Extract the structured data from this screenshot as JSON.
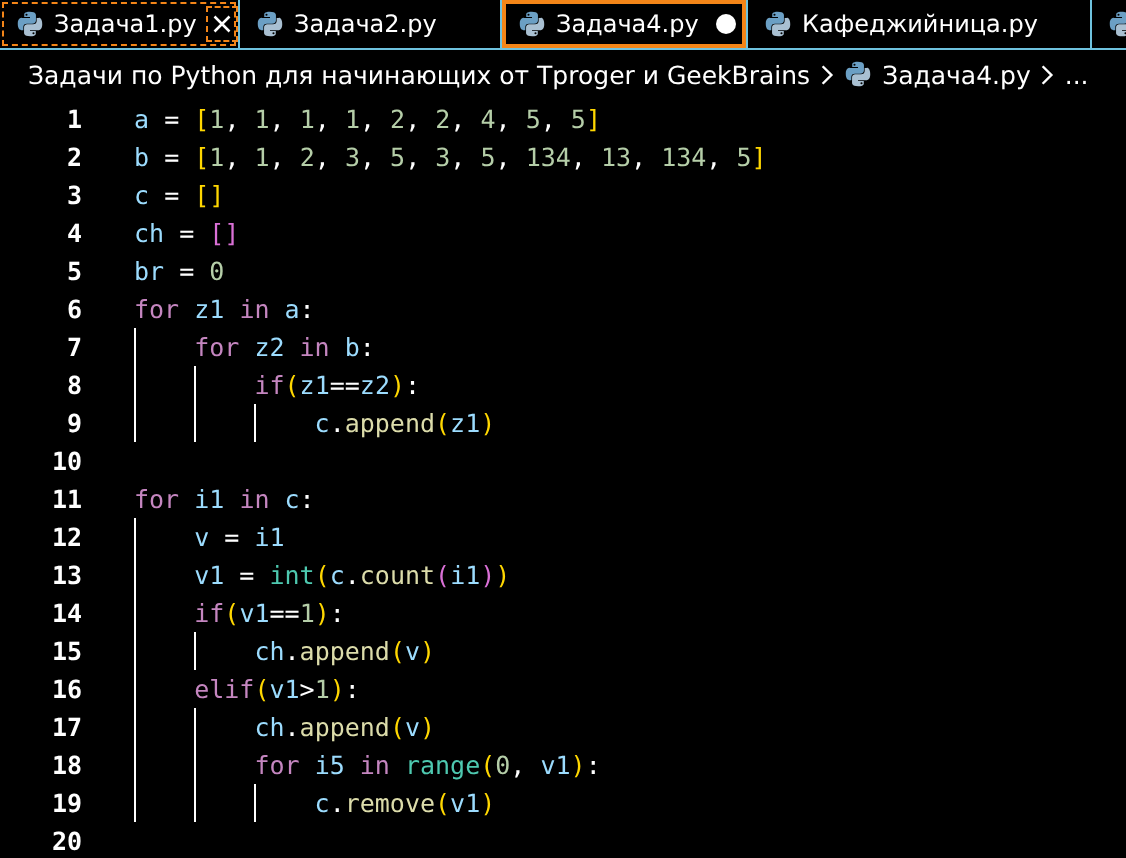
{
  "tabs": [
    {
      "label": "Задача1.py",
      "selected": false,
      "focused": true,
      "modified": false
    },
    {
      "label": "Задача2.py",
      "selected": false,
      "focused": false,
      "modified": false
    },
    {
      "label": "Задача4.py",
      "selected": true,
      "focused": false,
      "modified": true
    },
    {
      "label": "Кафеджийница.py",
      "selected": false,
      "focused": false,
      "modified": false
    }
  ],
  "partial_tab": true,
  "breadcrumb": {
    "folder": "Задачи по Python для начинающих от Tproger и GeekBrains",
    "file": "Задача4.py",
    "more": "..."
  },
  "editor": {
    "lines": [
      {
        "number": "1",
        "tokens": [
          {
            "kind": "var",
            "text": "a "
          },
          {
            "kind": "op",
            "text": "= "
          },
          {
            "kind": "bracket",
            "text": "["
          },
          {
            "kind": "num",
            "text": "1"
          },
          {
            "kind": "op",
            "text": ", "
          },
          {
            "kind": "num",
            "text": "1"
          },
          {
            "kind": "op",
            "text": ", "
          },
          {
            "kind": "num",
            "text": "1"
          },
          {
            "kind": "op",
            "text": ", "
          },
          {
            "kind": "num",
            "text": "1"
          },
          {
            "kind": "op",
            "text": ", "
          },
          {
            "kind": "num",
            "text": "2"
          },
          {
            "kind": "op",
            "text": ", "
          },
          {
            "kind": "num",
            "text": "2"
          },
          {
            "kind": "op",
            "text": ", "
          },
          {
            "kind": "num",
            "text": "4"
          },
          {
            "kind": "op",
            "text": ", "
          },
          {
            "kind": "num",
            "text": "5"
          },
          {
            "kind": "op",
            "text": ", "
          },
          {
            "kind": "num",
            "text": "5"
          },
          {
            "kind": "bracket",
            "text": "]"
          }
        ]
      },
      {
        "number": "2",
        "tokens": [
          {
            "kind": "var",
            "text": "b "
          },
          {
            "kind": "op",
            "text": "= "
          },
          {
            "kind": "bracket",
            "text": "["
          },
          {
            "kind": "num",
            "text": "1"
          },
          {
            "kind": "op",
            "text": ", "
          },
          {
            "kind": "num",
            "text": "1"
          },
          {
            "kind": "op",
            "text": ", "
          },
          {
            "kind": "num",
            "text": "2"
          },
          {
            "kind": "op",
            "text": ", "
          },
          {
            "kind": "num",
            "text": "3"
          },
          {
            "kind": "op",
            "text": ", "
          },
          {
            "kind": "num",
            "text": "5"
          },
          {
            "kind": "op",
            "text": ", "
          },
          {
            "kind": "num",
            "text": "3"
          },
          {
            "kind": "op",
            "text": ", "
          },
          {
            "kind": "num",
            "text": "5"
          },
          {
            "kind": "op",
            "text": ", "
          },
          {
            "kind": "num",
            "text": "134"
          },
          {
            "kind": "op",
            "text": ", "
          },
          {
            "kind": "num",
            "text": "13"
          },
          {
            "kind": "op",
            "text": ", "
          },
          {
            "kind": "num",
            "text": "134"
          },
          {
            "kind": "op",
            "text": ", "
          },
          {
            "kind": "num",
            "text": "5"
          },
          {
            "kind": "bracket",
            "text": "]"
          }
        ]
      },
      {
        "number": "3",
        "tokens": [
          {
            "kind": "var",
            "text": "c "
          },
          {
            "kind": "op",
            "text": "= "
          },
          {
            "kind": "bracket",
            "text": "[]"
          }
        ]
      },
      {
        "number": "4",
        "tokens": [
          {
            "kind": "var",
            "text": "ch "
          },
          {
            "kind": "op",
            "text": "= "
          },
          {
            "kind": "bracket2",
            "text": "[]"
          }
        ]
      },
      {
        "number": "5",
        "tokens": [
          {
            "kind": "var",
            "text": "br "
          },
          {
            "kind": "op",
            "text": "= "
          },
          {
            "kind": "num",
            "text": "0"
          }
        ]
      },
      {
        "number": "6",
        "tokens": [
          {
            "kind": "keyword",
            "text": "for "
          },
          {
            "kind": "var",
            "text": "z1 "
          },
          {
            "kind": "keyword",
            "text": "in "
          },
          {
            "kind": "var",
            "text": "a"
          },
          {
            "kind": "op",
            "text": ":"
          }
        ],
        "children": [
          {
            "number": "7",
            "tokens": [
              {
                "kind": "keyword",
                "text": "for "
              },
              {
                "kind": "var",
                "text": "z2 "
              },
              {
                "kind": "keyword",
                "text": "in "
              },
              {
                "kind": "var",
                "text": "b"
              },
              {
                "kind": "op",
                "text": ":"
              }
            ],
            "children": [
              {
                "number": "8",
                "tokens": [
                  {
                    "kind": "keyword",
                    "text": "if"
                  },
                  {
                    "kind": "bracket",
                    "text": "("
                  },
                  {
                    "kind": "var",
                    "text": "z1"
                  },
                  {
                    "kind": "op",
                    "text": "=="
                  },
                  {
                    "kind": "var",
                    "text": "z2"
                  },
                  {
                    "kind": "bracket",
                    "text": ")"
                  },
                  {
                    "kind": "op",
                    "text": ":"
                  }
                ],
                "children": [
                  {
                    "number": "9",
                    "tokens": [
                      {
                        "kind": "var",
                        "text": "c"
                      },
                      {
                        "kind": "op",
                        "text": "."
                      },
                      {
                        "kind": "func",
                        "text": "append"
                      },
                      {
                        "kind": "bracket",
                        "text": "("
                      },
                      {
                        "kind": "var",
                        "text": "z1"
                      },
                      {
                        "kind": "bracket",
                        "text": ")"
                      }
                    ]
                  }
                ]
              }
            ]
          }
        ]
      },
      {
        "number": "10"
      },
      {
        "number": "11",
        "tokens": [
          {
            "kind": "keyword",
            "text": "for "
          },
          {
            "kind": "var",
            "text": "i1 "
          },
          {
            "kind": "keyword",
            "text": "in "
          },
          {
            "kind": "var",
            "text": "c"
          },
          {
            "kind": "op",
            "text": ":"
          }
        ],
        "children": [
          {
            "number": "12",
            "tokens": [
              {
                "kind": "var",
                "text": "v "
              },
              {
                "kind": "op",
                "text": "= "
              },
              {
                "kind": "var",
                "text": "i1"
              }
            ]
          },
          {
            "number": "13",
            "tokens": [
              {
                "kind": "var",
                "text": "v1 "
              },
              {
                "kind": "op",
                "text": "= "
              },
              {
                "kind": "builtin",
                "text": "int"
              },
              {
                "kind": "bracket",
                "text": "("
              },
              {
                "kind": "var",
                "text": "c"
              },
              {
                "kind": "op",
                "text": "."
              },
              {
                "kind": "func",
                "text": "count"
              },
              {
                "kind": "bracket2",
                "text": "("
              },
              {
                "kind": "var",
                "text": "i1"
              },
              {
                "kind": "bracket2",
                "text": ")"
              },
              {
                "kind": "bracket",
                "text": ")"
              }
            ]
          },
          {
            "number": "14",
            "tokens": [
              {
                "kind": "keyword",
                "text": "if"
              },
              {
                "kind": "bracket",
                "text": "("
              },
              {
                "kind": "var",
                "text": "v1"
              },
              {
                "kind": "op",
                "text": "=="
              },
              {
                "kind": "num",
                "text": "1"
              },
              {
                "kind": "bracket",
                "text": ")"
              },
              {
                "kind": "op",
                "text": ":"
              }
            ],
            "children": [
              {
                "number": "15",
                "tokens": [
                  {
                    "kind": "var",
                    "text": "ch"
                  },
                  {
                    "kind": "op",
                    "text": "."
                  },
                  {
                    "kind": "func",
                    "text": "append"
                  },
                  {
                    "kind": "bracket",
                    "text": "("
                  },
                  {
                    "kind": "var",
                    "text": "v"
                  },
                  {
                    "kind": "bracket",
                    "text": ")"
                  }
                ]
              }
            ]
          },
          {
            "number": "16",
            "tokens": [
              {
                "kind": "keyword",
                "text": "elif"
              },
              {
                "kind": "bracket",
                "text": "("
              },
              {
                "kind": "var",
                "text": "v1"
              },
              {
                "kind": "op",
                "text": ">"
              },
              {
                "kind": "num",
                "text": "1"
              },
              {
                "kind": "bracket",
                "text": ")"
              },
              {
                "kind": "op",
                "text": ":"
              }
            ],
            "children": [
              {
                "number": "17",
                "tokens": [
                  {
                    "kind": "var",
                    "text": "ch"
                  },
                  {
                    "kind": "op",
                    "text": "."
                  },
                  {
                    "kind": "func",
                    "text": "append"
                  },
                  {
                    "kind": "bracket",
                    "text": "("
                  },
                  {
                    "kind": "var",
                    "text": "v"
                  },
                  {
                    "kind": "bracket",
                    "text": ")"
                  }
                ]
              },
              {
                "number": "18",
                "tokens": [
                  {
                    "kind": "keyword",
                    "text": "for "
                  },
                  {
                    "kind": "var",
                    "text": "i5 "
                  },
                  {
                    "kind": "keyword",
                    "text": "in "
                  },
                  {
                    "kind": "builtin",
                    "text": "range"
                  },
                  {
                    "kind": "bracket",
                    "text": "("
                  },
                  {
                    "kind": "num",
                    "text": "0"
                  },
                  {
                    "kind": "op",
                    "text": ", "
                  },
                  {
                    "kind": "var",
                    "text": "v1"
                  },
                  {
                    "kind": "bracket",
                    "text": ")"
                  },
                  {
                    "kind": "op",
                    "text": ":"
                  }
                ],
                "children": [
                  {
                    "number": "19",
                    "tokens": [
                      {
                        "kind": "var",
                        "text": "c"
                      },
                      {
                        "kind": "op",
                        "text": "."
                      },
                      {
                        "kind": "func",
                        "text": "remove"
                      },
                      {
                        "kind": "bracket",
                        "text": "("
                      },
                      {
                        "kind": "var",
                        "text": "v1"
                      },
                      {
                        "kind": "bracket",
                        "text": ")"
                      }
                    ]
                  }
                ]
              }
            ]
          }
        ]
      },
      {
        "number": "20"
      }
    ]
  }
}
